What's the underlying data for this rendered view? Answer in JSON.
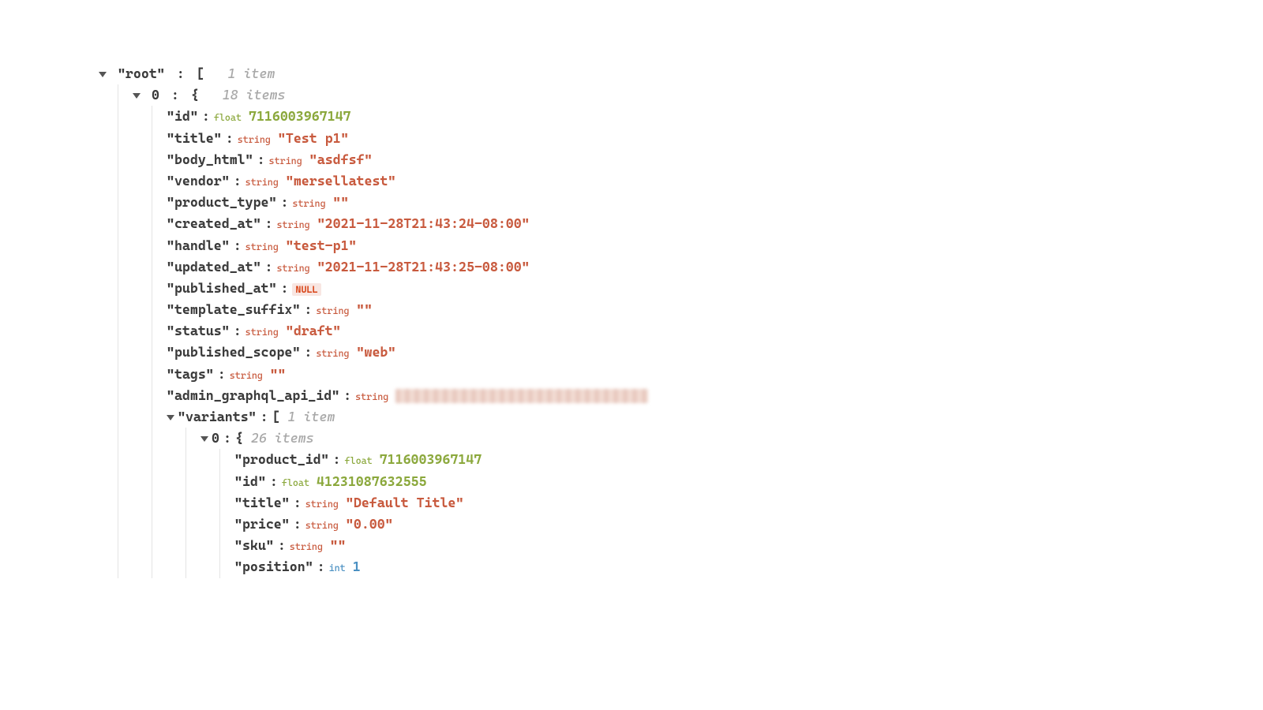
{
  "root": {
    "key": "\"root\"",
    "open_bracket": "[",
    "count_text": "1 item",
    "items": [
      {
        "index": "0",
        "open_bracket": "{",
        "count_text": "18 items",
        "fields": [
          {
            "key": "\"id\"",
            "type": "float",
            "value": "7116003967147",
            "vclass": "val-float",
            "tclass": "type-float"
          },
          {
            "key": "\"title\"",
            "type": "string",
            "value": "\"Test p1\"",
            "vclass": "val-string",
            "tclass": "type-string"
          },
          {
            "key": "\"body_html\"",
            "type": "string",
            "value": "\"asdfsf\"",
            "vclass": "val-string",
            "tclass": "type-string"
          },
          {
            "key": "\"vendor\"",
            "type": "string",
            "value": "\"mersellatest\"",
            "vclass": "val-string",
            "tclass": "type-string"
          },
          {
            "key": "\"product_type\"",
            "type": "string",
            "value": "\"\"",
            "vclass": "val-string",
            "tclass": "type-string"
          },
          {
            "key": "\"created_at\"",
            "type": "string",
            "value": "\"2021-11-28T21:43:24-08:00\"",
            "vclass": "val-string",
            "tclass": "type-string"
          },
          {
            "key": "\"handle\"",
            "type": "string",
            "value": "\"test-p1\"",
            "vclass": "val-string",
            "tclass": "type-string"
          },
          {
            "key": "\"updated_at\"",
            "type": "string",
            "value": "\"2021-11-28T21:43:25-08:00\"",
            "vclass": "val-string",
            "tclass": "type-string"
          },
          {
            "key": "\"published_at\"",
            "type": "NULL",
            "value": "NULL",
            "vclass": "null-tag",
            "tclass": ""
          },
          {
            "key": "\"template_suffix\"",
            "type": "string",
            "value": "\"\"",
            "vclass": "val-string",
            "tclass": "type-string"
          },
          {
            "key": "\"status\"",
            "type": "string",
            "value": "\"draft\"",
            "vclass": "val-string",
            "tclass": "type-string"
          },
          {
            "key": "\"published_scope\"",
            "type": "string",
            "value": "\"web\"",
            "vclass": "val-string",
            "tclass": "type-string"
          },
          {
            "key": "\"tags\"",
            "type": "string",
            "value": "\"\"",
            "vclass": "val-string",
            "tclass": "type-string"
          },
          {
            "key": "\"admin_graphql_api_id\"",
            "type": "string",
            "value": "",
            "vclass": "val-string",
            "tclass": "type-string",
            "redacted": true
          }
        ],
        "variants": {
          "key": "\"variants\"",
          "open_bracket": "[",
          "count_text": "1 item",
          "items": [
            {
              "index": "0",
              "open_bracket": "{",
              "count_text": "26 items",
              "fields": [
                {
                  "key": "\"product_id\"",
                  "type": "float",
                  "value": "7116003967147",
                  "vclass": "val-float",
                  "tclass": "type-float"
                },
                {
                  "key": "\"id\"",
                  "type": "float",
                  "value": "41231087632555",
                  "vclass": "val-float",
                  "tclass": "type-float"
                },
                {
                  "key": "\"title\"",
                  "type": "string",
                  "value": "\"Default Title\"",
                  "vclass": "val-string",
                  "tclass": "type-string"
                },
                {
                  "key": "\"price\"",
                  "type": "string",
                  "value": "\"0.00\"",
                  "vclass": "val-string",
                  "tclass": "type-string"
                },
                {
                  "key": "\"sku\"",
                  "type": "string",
                  "value": "\"\"",
                  "vclass": "val-string",
                  "tclass": "type-string"
                },
                {
                  "key": "\"position\"",
                  "type": "int",
                  "value": "1",
                  "vclass": "val-int",
                  "tclass": "type-int"
                }
              ]
            }
          ]
        }
      }
    ]
  }
}
